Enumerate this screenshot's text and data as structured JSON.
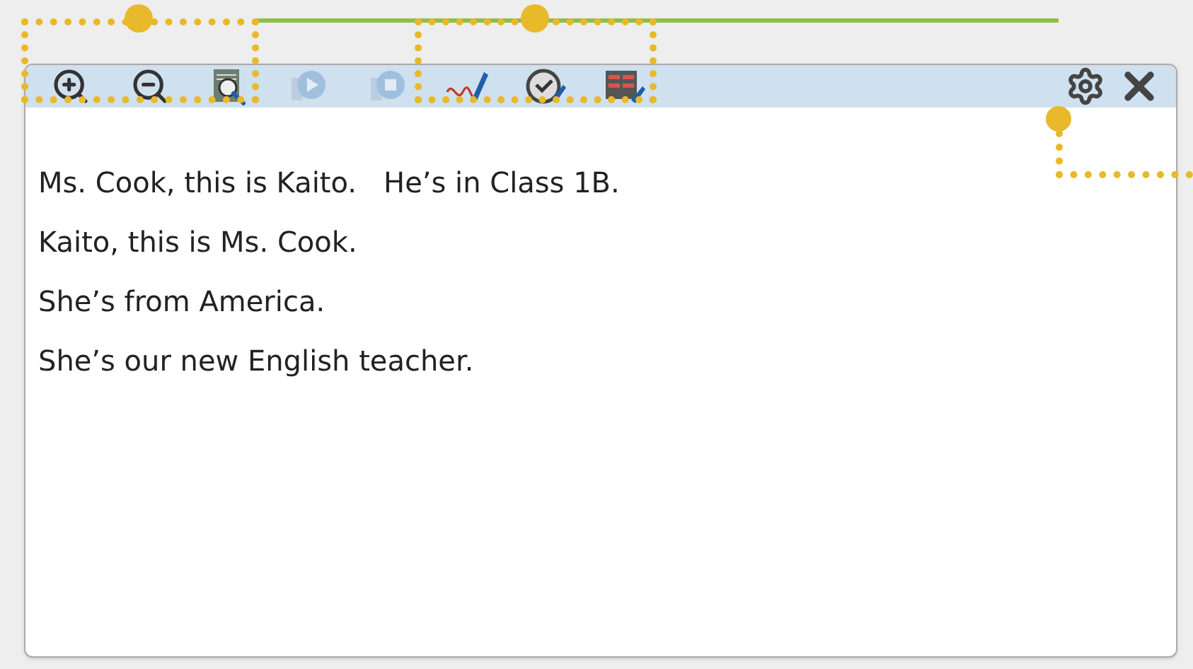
{
  "toolbar": {
    "tools": [
      {
        "kind": "zoom-in",
        "disabled": false
      },
      {
        "kind": "zoom-out",
        "disabled": false
      },
      {
        "kind": "actual-size",
        "disabled": false
      },
      {
        "kind": "play",
        "disabled": true
      },
      {
        "kind": "stop",
        "disabled": true
      },
      {
        "kind": "pen",
        "disabled": false
      },
      {
        "kind": "check",
        "disabled": false
      },
      {
        "kind": "form",
        "disabled": false
      }
    ]
  },
  "lines": [
    "Ms. Cook, this is Kaito.   He’s in Class 1B.",
    "Kaito, this is Ms. Cook.",
    "She’s from America.",
    "She’s our new English teacher."
  ]
}
